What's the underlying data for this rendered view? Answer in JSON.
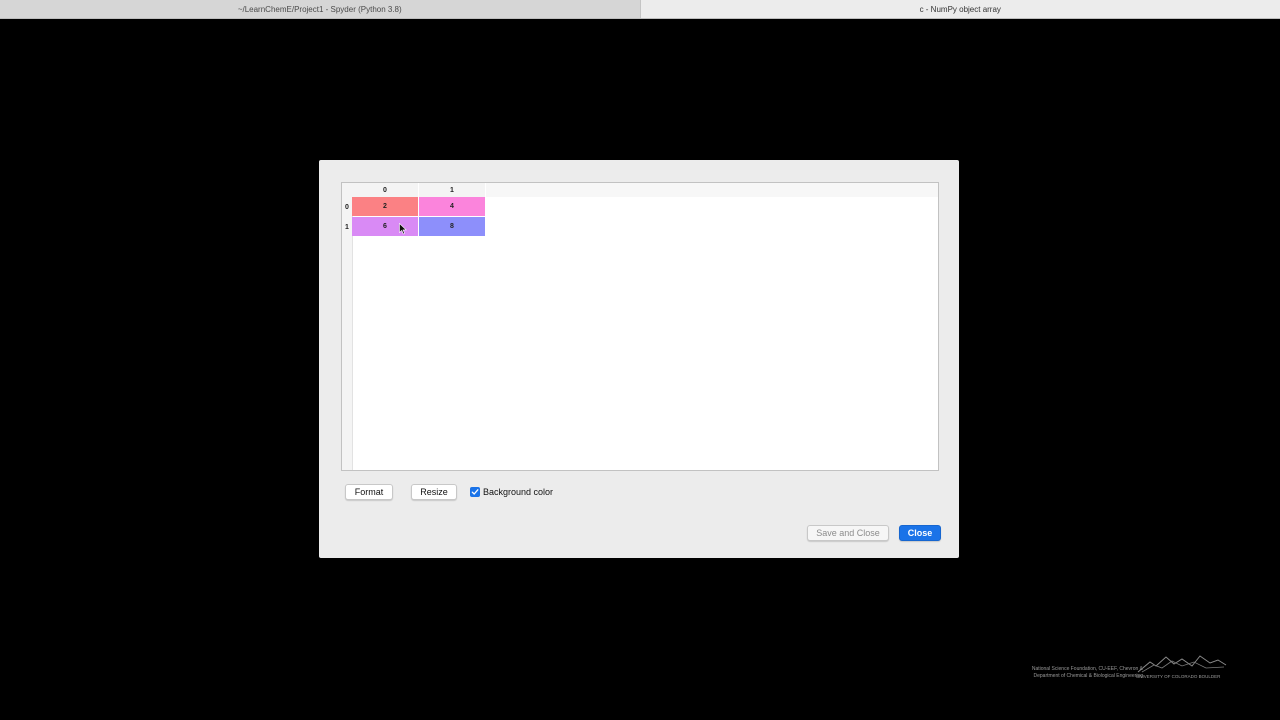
{
  "tabs": [
    {
      "label": "~/LearnChemE/Project1 - Spyder (Python 3.8)"
    },
    {
      "label": "c - NumPy object array"
    }
  ],
  "table": {
    "columns": [
      "0",
      "1"
    ],
    "rows": [
      "0",
      "1"
    ],
    "cells": [
      [
        "2",
        "4"
      ],
      [
        "6",
        "8"
      ]
    ],
    "cell_colors": [
      [
        "#fb8184",
        "#fb84dc"
      ],
      [
        "#d98af5",
        "#8d8ffb"
      ]
    ]
  },
  "controls": {
    "format_label": "Format",
    "resize_label": "Resize",
    "background_color_label": "Background color",
    "background_color_checked": true,
    "save_and_close_label": "Save and Close",
    "close_label": "Close"
  },
  "footer": {
    "line1": "National Science Foundation, CU-EEF, Chevron &",
    "line2": "Department of Chemical & Biological Engineering",
    "university": "UNIVERSITY OF COLORADO BOULDER"
  },
  "colors": {
    "accent": "#1a73e8",
    "background": "#000000",
    "dialog": "#ececec"
  }
}
